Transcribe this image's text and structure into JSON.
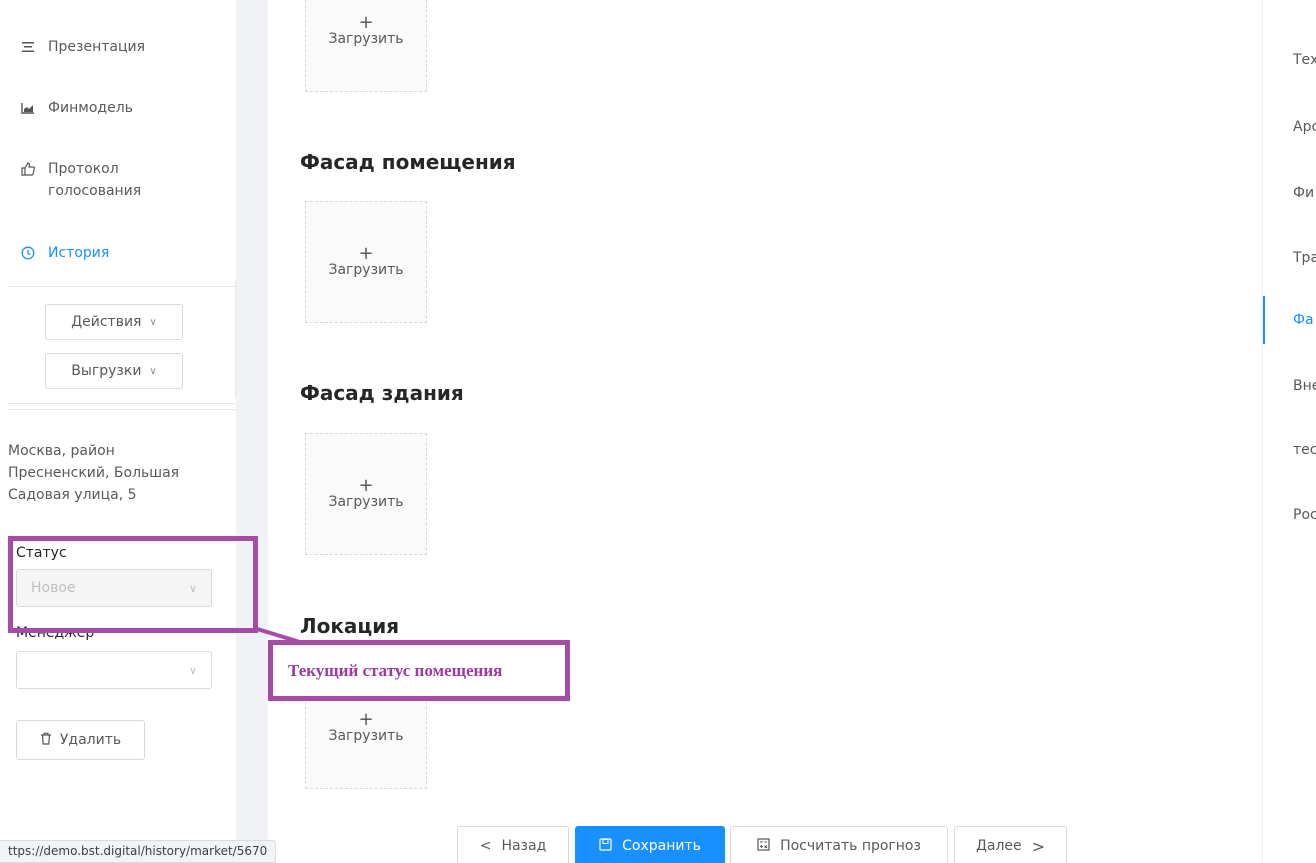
{
  "sidebar": {
    "nav": [
      {
        "label": "Презентация",
        "icon": "presentation-icon",
        "active": false
      },
      {
        "label": "Финмодель",
        "icon": "area-chart-icon",
        "active": false
      },
      {
        "label": "Протокол голосования",
        "icon": "like-icon",
        "active": false
      },
      {
        "label": "История",
        "icon": "clock-icon",
        "active": true
      }
    ],
    "actions_label": "Действия",
    "exports_label": "Выгрузки",
    "address": "Москва, район Пресненский, Большая Садовая улица, 5",
    "status_label": "Статус",
    "status_value": "Новое",
    "manager_label": "Менеджер",
    "manager_value": "",
    "delete_label": "Удалить"
  },
  "main": {
    "top_upload_label": "Загрузить",
    "sections": [
      {
        "title": "Фасад помещения",
        "upload_label": "Загрузить"
      },
      {
        "title": "Фасад здания",
        "upload_label": "Загрузить"
      },
      {
        "title": "Локация",
        "upload_label": "Загрузить"
      }
    ]
  },
  "annotation": {
    "callout_text": "Текущий статус помещения",
    "color": "#a64ca6"
  },
  "footer": {
    "back_label": "Назад",
    "save_label": "Сохранить",
    "forecast_label": "Посчитать прогноз",
    "next_label": "Далее"
  },
  "right_nav": {
    "items": [
      {
        "label": "Тех",
        "active": false
      },
      {
        "label": "Арс",
        "active": false
      },
      {
        "label": "Фи",
        "active": false
      },
      {
        "label": "Тра",
        "active": false
      },
      {
        "label": "Фа",
        "active": true
      },
      {
        "label": "Вне",
        "active": false
      },
      {
        "label": "тес",
        "active": false
      },
      {
        "label": "Рос",
        "active": false
      }
    ]
  },
  "statusbar": {
    "url": "ttps://demo.bst.digital/history/market/5670"
  },
  "colors": {
    "primary": "#1890ff",
    "annotation": "#a64ca6",
    "gutter": "#f0f2f5"
  }
}
